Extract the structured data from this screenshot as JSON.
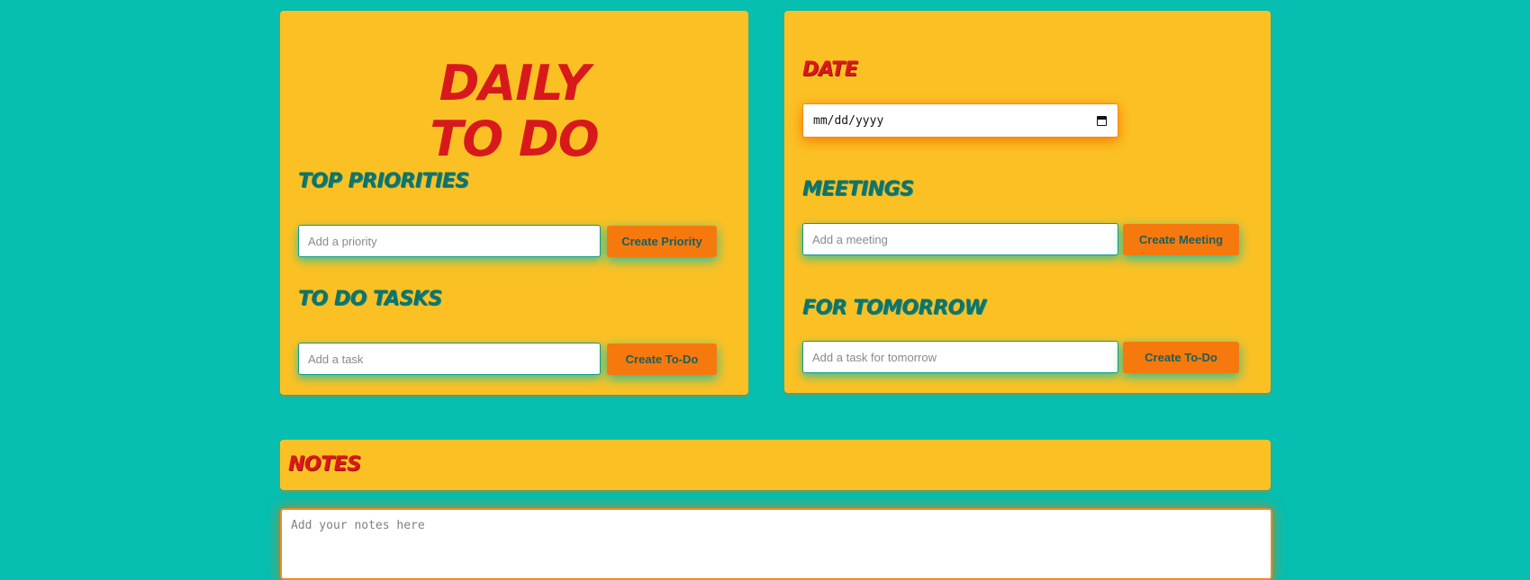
{
  "app": {
    "title_line1": "Daily",
    "title_line2": "To Do"
  },
  "sections": {
    "top_priorities": {
      "heading": "Top Priorities",
      "placeholder": "Add a priority",
      "button_label": "Create Priority"
    },
    "todo_tasks": {
      "heading": "To Do Tasks",
      "placeholder": "Add a task",
      "button_label": "Create To-Do"
    },
    "date": {
      "heading": "Date",
      "value_display": "mm/dd/yyyy"
    },
    "meetings": {
      "heading": "Meetings",
      "placeholder": "Add a meeting",
      "button_label": "Create Meeting"
    },
    "for_tomorrow": {
      "heading": "For Tomorrow",
      "placeholder": "Add a task for tomorrow",
      "button_label": "Create To-Do"
    },
    "notes": {
      "heading": "Notes",
      "placeholder": "Add your notes here"
    }
  },
  "colors": {
    "background": "#06bfb0",
    "card": "#fbc124",
    "title_red": "#d8191c",
    "heading_teal": "#137268",
    "button_orange": "#f6790e"
  },
  "icons": {
    "date_picker": "calendar-icon"
  }
}
